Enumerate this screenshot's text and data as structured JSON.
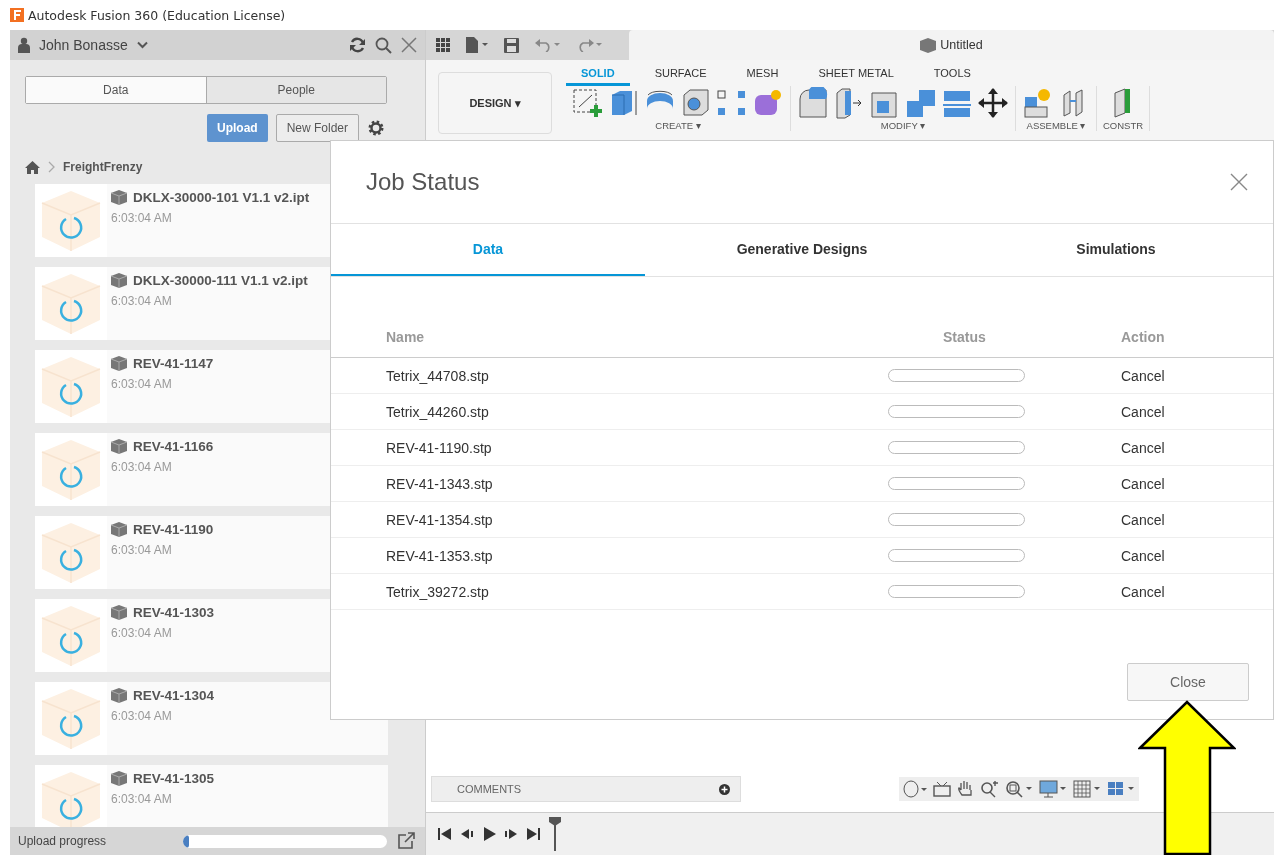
{
  "window": {
    "title": "Autodesk Fusion 360 (Education License)"
  },
  "data_panel": {
    "user": "John Bonasse",
    "tabs": [
      {
        "label": "Data",
        "selected": true
      },
      {
        "label": "People",
        "selected": false
      }
    ],
    "upload_button": "Upload",
    "new_folder_button": "New Folder",
    "breadcrumb": "FreightFrenzy",
    "files": [
      {
        "name": "DKLX-30000-101 V1.1 v2.ipt",
        "time": "6:03:04 AM"
      },
      {
        "name": "DKLX-30000-111 V1.1 v2.ipt",
        "time": "6:03:04 AM"
      },
      {
        "name": "REV-41-1147",
        "time": "6:03:04 AM"
      },
      {
        "name": "REV-41-1166",
        "time": "6:03:04 AM"
      },
      {
        "name": "REV-41-1190",
        "time": "6:03:04 AM"
      },
      {
        "name": "REV-41-1303",
        "time": "6:03:04 AM"
      },
      {
        "name": "REV-41-1304",
        "time": "6:03:04 AM"
      },
      {
        "name": "REV-41-1305",
        "time": "6:03:04 AM"
      }
    ],
    "upload_progress": {
      "label": "Upload progress",
      "level": 0.03
    }
  },
  "document_tab": "Untitled",
  "toolbar": {
    "workspace": "DESIGN ▾",
    "tabs": [
      {
        "label": "SOLID",
        "selected": true
      },
      {
        "label": "SURFACE",
        "selected": false
      },
      {
        "label": "MESH",
        "selected": false
      },
      {
        "label": "SHEET METAL",
        "selected": false
      },
      {
        "label": "TOOLS",
        "selected": false
      }
    ],
    "groups": [
      "CREATE ▾",
      "MODIFY ▾",
      "ASSEMBLE ▾",
      "CONSTR"
    ]
  },
  "comments": "COMMENTS",
  "dialog": {
    "title": "Job Status",
    "tabs": [
      {
        "label": "Data",
        "selected": true
      },
      {
        "label": "Generative Designs",
        "selected": false
      },
      {
        "label": "Simulations",
        "selected": false
      }
    ],
    "columns": [
      "Name",
      "Status",
      "Action"
    ],
    "jobs": [
      {
        "name": "Tetrix_44708.stp",
        "level": 0,
        "action": "Cancel"
      },
      {
        "name": "Tetrix_44260.stp",
        "level": 0,
        "action": "Cancel"
      },
      {
        "name": "REV-41-1190.stp",
        "level": 0,
        "action": "Cancel"
      },
      {
        "name": "REV-41-1343.stp",
        "level": 0,
        "action": "Cancel"
      },
      {
        "name": "REV-41-1354.stp",
        "level": 0,
        "action": "Cancel"
      },
      {
        "name": "REV-41-1353.stp",
        "level": 0,
        "action": "Cancel"
      },
      {
        "name": "Tetrix_39272.stp",
        "level": 0,
        "action": "Cancel"
      }
    ],
    "close_button": "Close"
  }
}
